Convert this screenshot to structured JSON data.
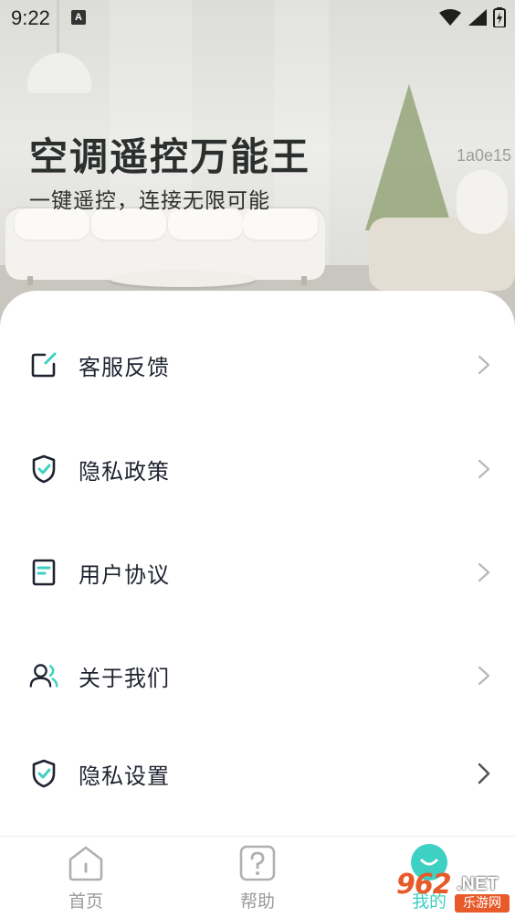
{
  "status_bar": {
    "time": "9:22",
    "notification_badge": "A"
  },
  "hero": {
    "title": "空调遥控万能王",
    "subtitle": "一键遥控，连接无限可能",
    "code": "1a0e15"
  },
  "menu": {
    "items": [
      {
        "label": "客服反馈",
        "icon": "edit-icon"
      },
      {
        "label": "隐私政策",
        "icon": "shield-check-icon"
      },
      {
        "label": "用户协议",
        "icon": "document-icon"
      },
      {
        "label": "关于我们",
        "icon": "user-icon"
      },
      {
        "label": "隐私设置",
        "icon": "shield-check-icon"
      }
    ]
  },
  "bottom_nav": {
    "items": [
      {
        "label": "首页",
        "icon": "home-icon"
      },
      {
        "label": "帮助",
        "icon": "help-icon"
      },
      {
        "label": "我的",
        "icon": "profile-icon"
      }
    ]
  },
  "watermark": {
    "brand": "962",
    "domain": ".NET",
    "sub": "乐游网"
  },
  "colors": {
    "accent": "#3ed0c2",
    "text_primary": "#1e2330",
    "text_muted": "#9a9a9a"
  }
}
